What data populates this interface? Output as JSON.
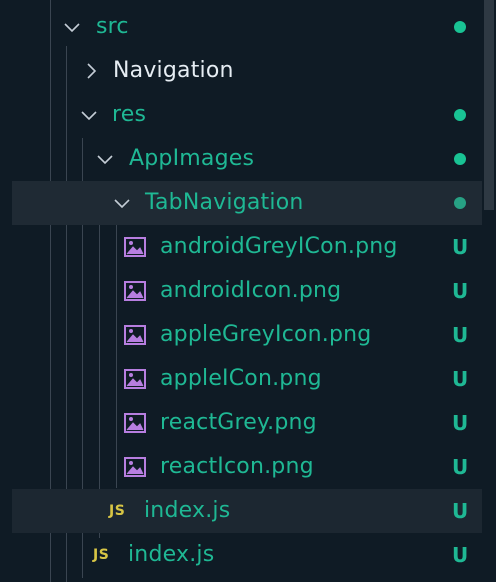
{
  "colors": {
    "background": "#0f1b25",
    "folder_text": "#1fb894",
    "plain_text": "#e6edf3",
    "dot": "#19c394",
    "badge": "#1fb894",
    "image_icon": "#b77ee0",
    "js_icon": "#d7c545",
    "chevron": "#c4cdd6"
  },
  "tree": {
    "src": {
      "label": "src",
      "expanded": true,
      "status": "dot"
    },
    "navigation": {
      "label": "Navigation",
      "expanded": false
    },
    "res": {
      "label": "res",
      "expanded": true,
      "status": "dot"
    },
    "app_images": {
      "label": "AppImages",
      "expanded": true,
      "status": "dot"
    },
    "tab_navigation": {
      "label": "TabNavigation",
      "expanded": true,
      "status": "dot"
    },
    "files": [
      {
        "label": "androidGreyICon.png",
        "badge": "U",
        "icon": "image-icon"
      },
      {
        "label": "androidIcon.png",
        "badge": "U",
        "icon": "image-icon"
      },
      {
        "label": "appleGreyIcon.png",
        "badge": "U",
        "icon": "image-icon"
      },
      {
        "label": "appleICon.png",
        "badge": "U",
        "icon": "image-icon"
      },
      {
        "label": "reactGrey.png",
        "badge": "U",
        "icon": "image-icon"
      },
      {
        "label": "reactIcon.png",
        "badge": "U",
        "icon": "image-icon"
      }
    ],
    "res_index": {
      "label": "index.js",
      "badge": "U",
      "icon_text": "JS"
    },
    "src_index": {
      "label": "index.js",
      "badge": "U",
      "icon_text": "JS"
    }
  }
}
